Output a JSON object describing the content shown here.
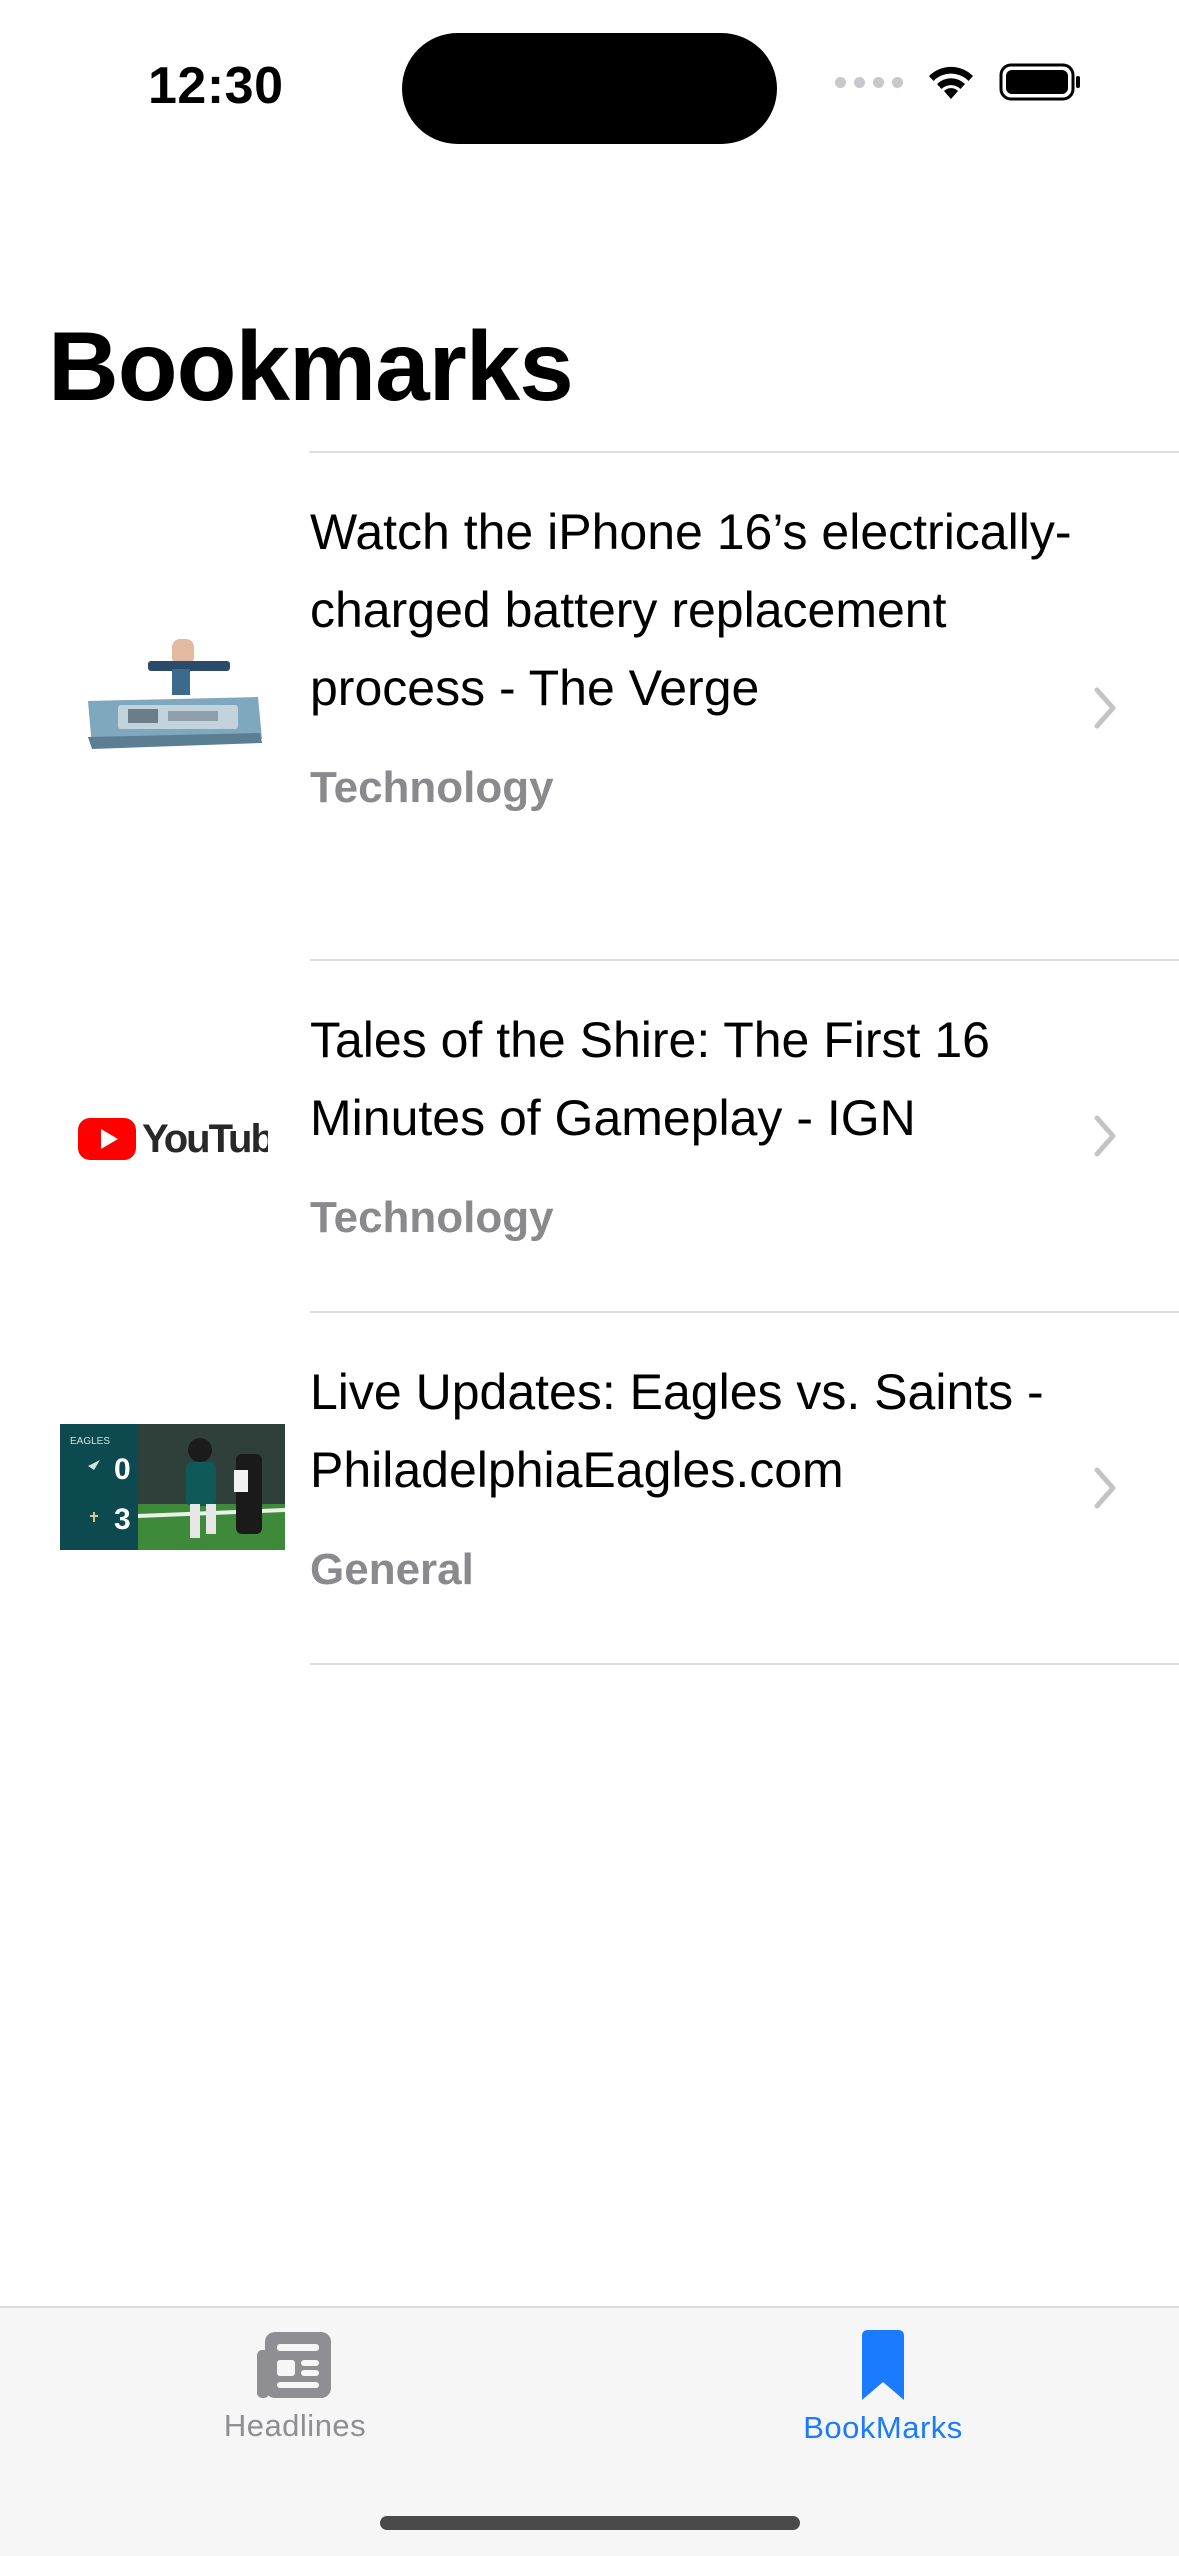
{
  "status_bar": {
    "time": "12:30"
  },
  "page": {
    "title": "Bookmarks"
  },
  "bookmarks": [
    {
      "title": "Watch the iPhone 16’s electrically-charged battery replacement process - The Verge",
      "category": "Technology",
      "thumbnail": "iphone-battery-photo"
    },
    {
      "title": "Tales of the Shire: The First 16 Minutes of Gameplay - IGN",
      "category": "Technology",
      "thumbnail": "youtube-logo",
      "thumbnail_text": "YouTube"
    },
    {
      "title": "Live Updates: Eagles vs. Saints - PhiladelphiaEagles.com",
      "category": "General",
      "thumbnail": "eagles-game-photo",
      "score": [
        "0",
        "3"
      ]
    }
  ],
  "tab_bar": {
    "tabs": [
      {
        "label": "Headlines",
        "icon": "newspaper-icon",
        "selected": false
      },
      {
        "label": "BookMarks",
        "icon": "bookmark-icon",
        "selected": true
      }
    ]
  },
  "colors": {
    "accent": "#1a7bff",
    "secondary_text": "#8a8a8e",
    "inactive_tab": "#8e8e93",
    "separator": "#dcdcdf"
  }
}
